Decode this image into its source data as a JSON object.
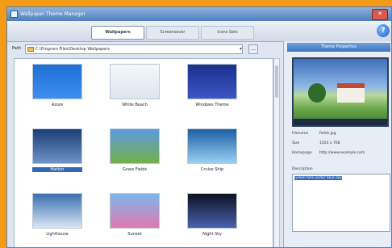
{
  "window": {
    "title": "Wallpaper Theme Manager",
    "close_glyph": "✕"
  },
  "tabs": [
    {
      "label": "Wallpapers",
      "active": true
    },
    {
      "label": "Screensaver",
      "active": false
    },
    {
      "label": "Icons Sets",
      "active": false
    }
  ],
  "help": {
    "glyph": "?"
  },
  "path": {
    "label": "Path",
    "value": "C:\\Program Files\\Desktop Wallpapers",
    "dropdown_glyph": "▾",
    "browse_glyph": "…"
  },
  "thumbnails": [
    {
      "caption": "Azure",
      "colors": [
        "#1e6fd6",
        "#3f8ff0"
      ]
    },
    {
      "caption": "White Beach",
      "colors": [
        "#f5f7fa",
        "#dde5ee"
      ]
    },
    {
      "caption": "Windows Theme",
      "colors": [
        "#1b2f8a",
        "#3b56c7"
      ]
    },
    {
      "caption": "Harbor",
      "colors": [
        "#1d3d78",
        "#6e93c6"
      ],
      "selected": true
    },
    {
      "caption": "Grass Fields",
      "colors": [
        "#5b9be0",
        "#74b049"
      ]
    },
    {
      "caption": "Cruise Ship",
      "colors": [
        "#1d5fa5",
        "#9ad0f0"
      ]
    },
    {
      "caption": "Lighthouse",
      "colors": [
        "#3a6fb0",
        "#d9e6f4"
      ]
    },
    {
      "caption": "Sunset",
      "colors": [
        "#7db6ea",
        "#e07ab0"
      ]
    },
    {
      "caption": "Night Sky",
      "colors": [
        "#0b1220",
        "#4a62b0"
      ]
    }
  ],
  "properties": {
    "header": "Theme Properties",
    "rows": [
      {
        "key": "Filename",
        "value": "fields.jpg"
      },
      {
        "key": "Size",
        "value": "1024 x 768"
      },
      {
        "key": "Homepage",
        "value": "http://www.example.com"
      }
    ],
    "description_label": "Description",
    "description_value": "Green hills under blue sky"
  }
}
